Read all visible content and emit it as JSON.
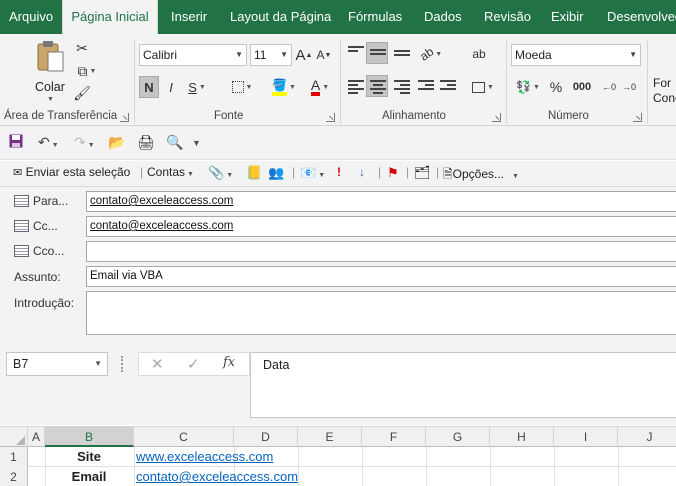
{
  "tabs": [
    "Arquivo",
    "Página Inicial",
    "Inserir",
    "Layout da Página",
    "Fórmulas",
    "Dados",
    "Revisão",
    "Exibir",
    "Desenvolvedor"
  ],
  "ribbon": {
    "clipboard": {
      "paste_label": "Colar",
      "group_label": "Área de Transferência"
    },
    "font": {
      "name": "Calibri",
      "size": "11",
      "bold": "N",
      "italic": "I",
      "underline": "S",
      "grow": "A",
      "shrink": "A",
      "group_label": "Fonte"
    },
    "alignment": {
      "group_label": "Alinhamento",
      "wrap_glyph": "ab"
    },
    "number": {
      "format": "Moeda",
      "percent": "%",
      "thousands": "000",
      "group_label": "Número"
    },
    "styles": {
      "partial_label_1": "For",
      "partial_label_2": "Conc"
    }
  },
  "mailbar": {
    "send_label": "Enviar esta seleção",
    "contacts_label": "Contas",
    "options_label": "Opções..."
  },
  "envelope": {
    "to_label": "Para...",
    "to_value": "contato@exceleaccess.com",
    "cc_label": "Cc...",
    "cc_value": "contato@exceleaccess.com",
    "bcc_label": "Cco...",
    "bcc_value": "",
    "subject_label": "Assunto:",
    "subject_value": "Email via VBA",
    "intro_label": "Introdução:",
    "intro_value": ""
  },
  "formula": {
    "namebox": "B7",
    "cancel": "✕",
    "confirm": "✓",
    "fx": "fx",
    "value": "Data"
  },
  "grid": {
    "columns": [
      "A",
      "B",
      "C",
      "D",
      "E",
      "F",
      "G",
      "H",
      "I",
      "J"
    ],
    "selected_column": "B",
    "rows": [
      {
        "num": "1",
        "b": "Site",
        "c": "www.exceleaccess.com"
      },
      {
        "num": "2",
        "b": "Email",
        "c": "contato@exceleaccess.com"
      }
    ]
  },
  "colors": {
    "excel_green": "#217346",
    "link": "#0563c1"
  }
}
